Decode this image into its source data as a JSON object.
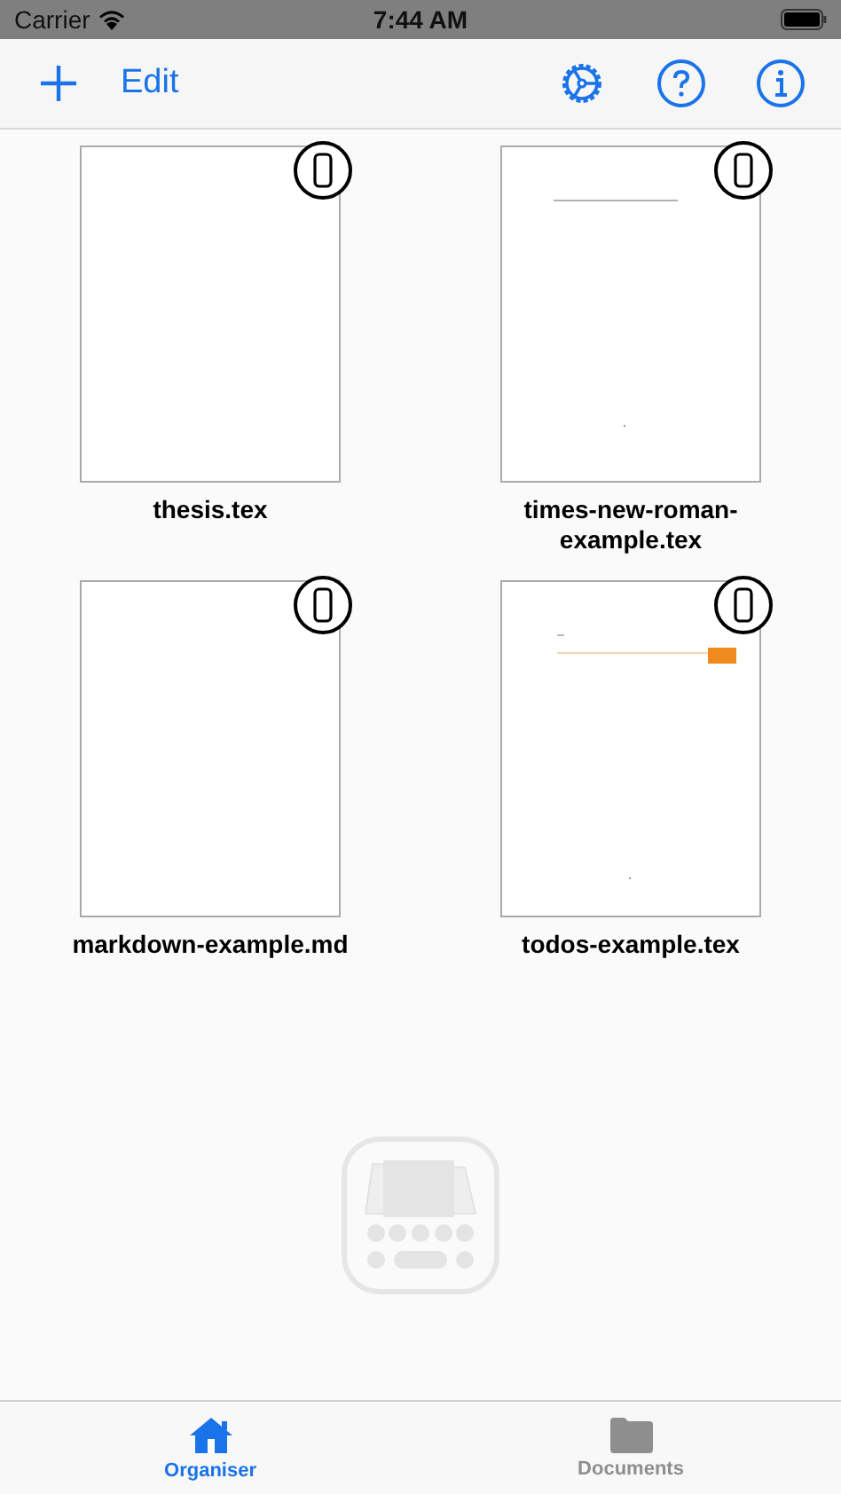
{
  "status_bar": {
    "carrier": "Carrier",
    "time": "7:44 AM"
  },
  "toolbar": {
    "edit": "Edit"
  },
  "documents": [
    {
      "name": "thesis.tex",
      "kind": "blank"
    },
    {
      "name": "times-new-roman-example.tex",
      "kind": "text"
    },
    {
      "name": "markdown-example.md",
      "kind": "blank"
    },
    {
      "name": "todos-example.tex",
      "kind": "todo"
    }
  ],
  "tabs": [
    {
      "label": "Organiser",
      "selected": true
    },
    {
      "label": "Documents",
      "selected": false
    }
  ]
}
